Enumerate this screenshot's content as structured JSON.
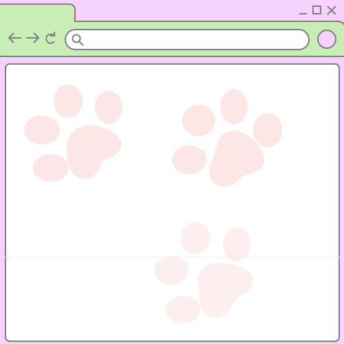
{
  "window": {
    "title": "",
    "controls": {
      "minimize_icon": "minimize-icon",
      "maximize_icon": "maximize-icon",
      "close_icon": "close-icon"
    }
  },
  "toolbar": {
    "back_icon": "arrow-left-icon",
    "forward_icon": "arrow-right-icon",
    "reload_icon": "reload-icon",
    "search_icon": "search-icon",
    "profile_icon": "profile-circle-icon"
  },
  "address_bar": {
    "value": "",
    "placeholder": ""
  },
  "content": {
    "decoration_icons": [
      "paw-print-icon",
      "paw-print-icon",
      "paw-print-icon"
    ]
  },
  "colors": {
    "window_background": "#f6d3ff",
    "toolbar_background": "#c8eeb5",
    "outline": "#7f7f7f",
    "content_background": "#ffffff",
    "paw_pink": "#fde6e6"
  }
}
